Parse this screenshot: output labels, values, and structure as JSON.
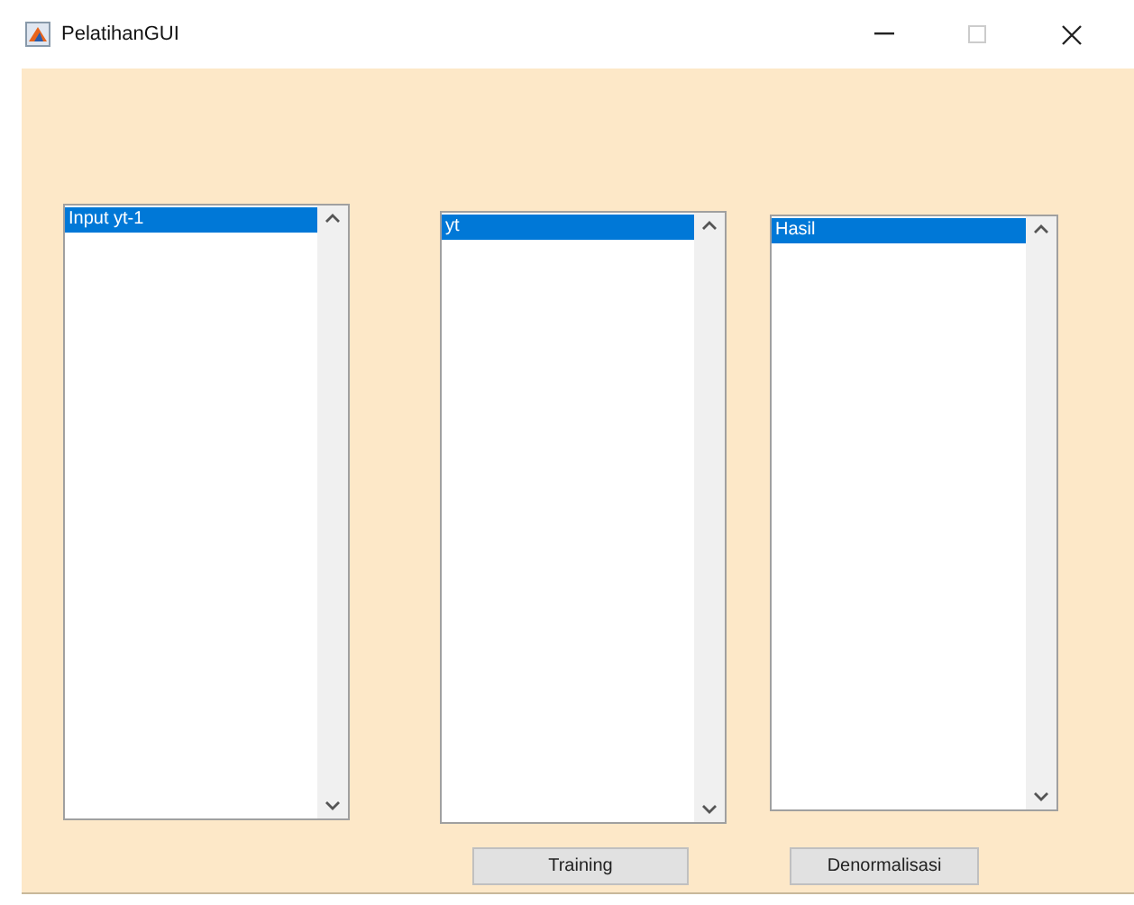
{
  "window": {
    "title": "PelatihanGUI"
  },
  "listboxes": [
    {
      "items": [
        {
          "label": "Input yt-1",
          "selected": true
        }
      ]
    },
    {
      "items": [
        {
          "label": "yt",
          "selected": true
        }
      ]
    },
    {
      "items": [
        {
          "label": "Hasil",
          "selected": true
        }
      ]
    }
  ],
  "buttons": [
    "Training",
    "Denormalisasi"
  ]
}
